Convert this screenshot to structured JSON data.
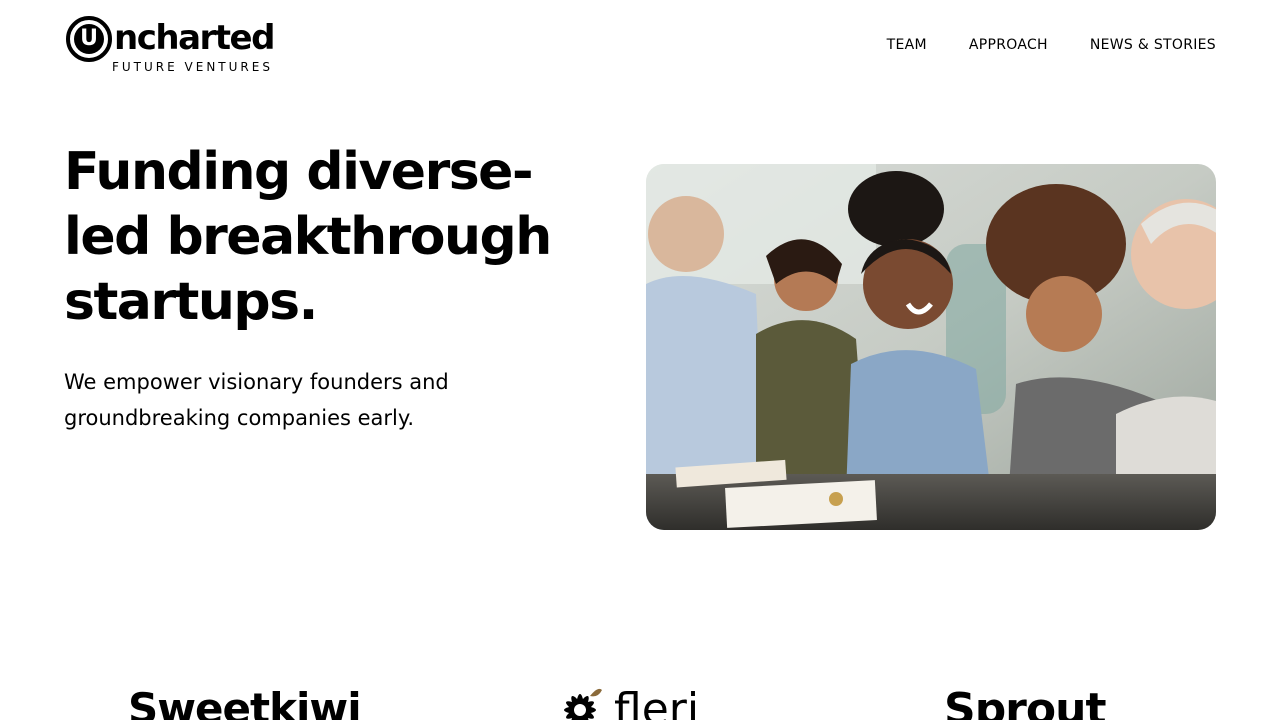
{
  "header": {
    "logo": {
      "word": "ncharted",
      "letter": "U",
      "sub": "FUTURE VENTURES"
    },
    "nav": [
      "TEAM",
      "APPROACH",
      "NEWS & STORIES"
    ]
  },
  "hero": {
    "line1": "Funding diverse-",
    "line2_pre": "led",
    "line2_hl": "breakthrough",
    "line3_hl": "startups.",
    "subtitle": "We empower visionary founders and groundbreaking companies early.",
    "image_alt": "Diverse team laughing around a meeting table",
    "highlight_color": "#f6bf1a"
  },
  "partners": [
    "Sweetkiwi",
    "fleri",
    "Sprout"
  ]
}
